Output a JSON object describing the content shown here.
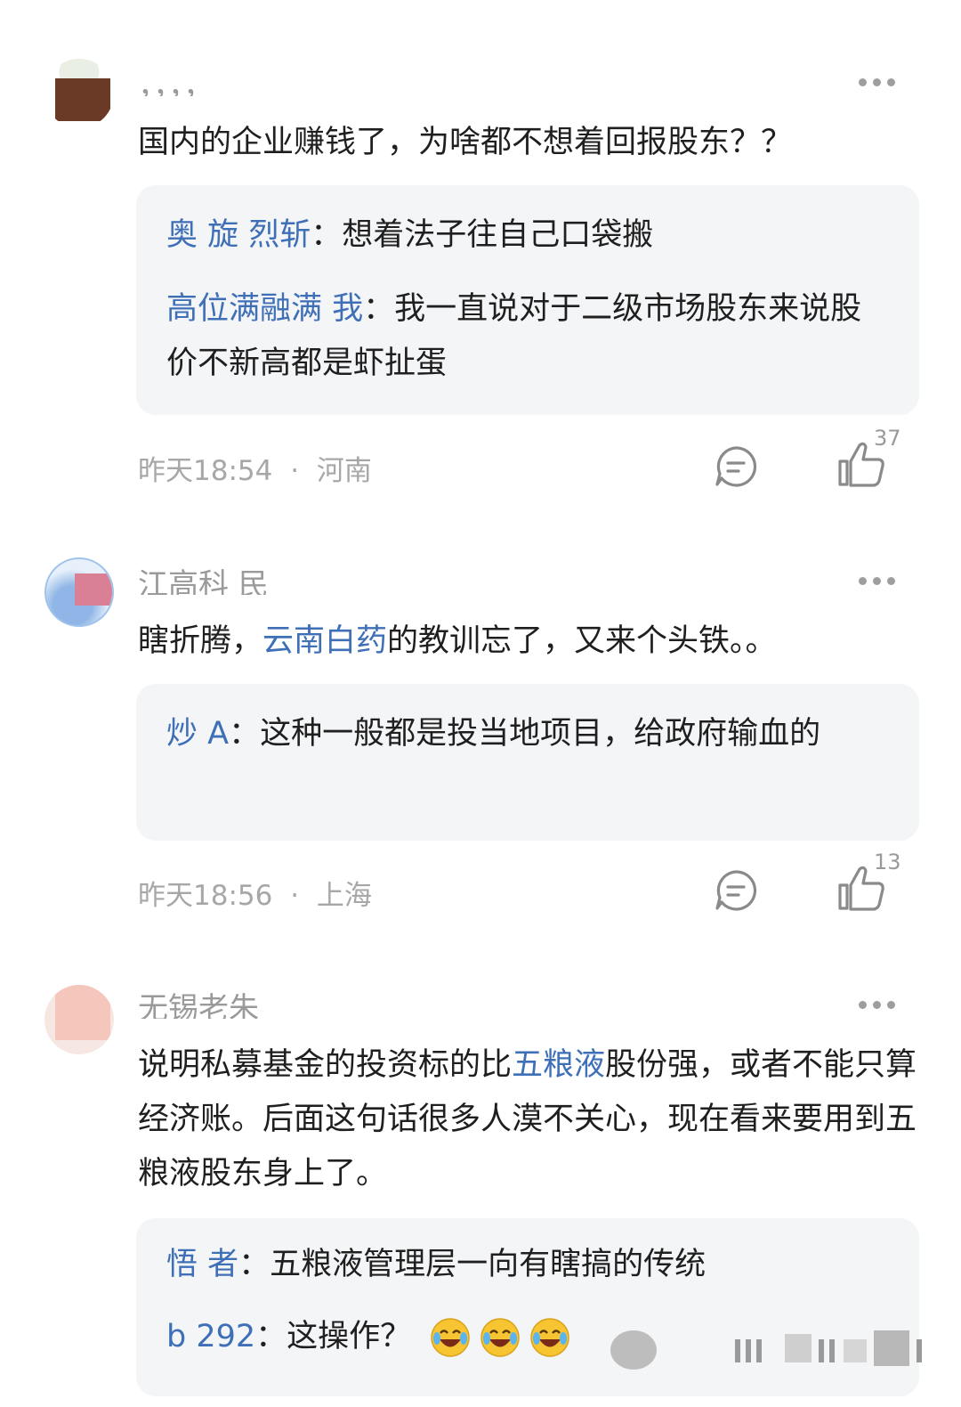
{
  "comments": [
    {
      "username": "，，，，",
      "text": "国内的企业赚钱了，为啥都不想着回报股东？？",
      "replies": [
        {
          "name": "奥 旋 烈斩",
          "sep": "：",
          "text": "想着法子往自己口袋搬"
        },
        {
          "name": "高位满融满 我",
          "sep": "：",
          "text": "我一直说对于二级市场股东来说股价不新高都是虾扯蛋"
        }
      ],
      "time": "昨天18:54",
      "dot": "·",
      "location": "河南",
      "likes": "37"
    },
    {
      "username": "江高科 民",
      "text_before": "瞎折腾，",
      "text_link": "云南白药",
      "text_after": "的教训忘了，又来个头铁。。",
      "replies": [
        {
          "name": "炒 A",
          "sep": "：",
          "text": "这种一般都是投当地项目，给政府输血的"
        }
      ],
      "time": "昨天18:56",
      "dot": "·",
      "location": "上海",
      "likes": "13"
    },
    {
      "username": "无锡老朱",
      "text_before": "说明私募基金的投资标的比",
      "text_link": "五粮液",
      "text_after": "股份强，或者不能只算经济账。后面这句话很多人漠不关心，现在看来要用到五粮液股东身上了。",
      "replies": [
        {
          "name": "悟 者",
          "sep": "：",
          "text": "五粮液管理层一向有瞎搞的传统"
        },
        {
          "name": "b 292",
          "sep": "：",
          "text": "这操作？"
        }
      ]
    }
  ],
  "icons": {
    "more": "more-dots-icon",
    "reply": "reply-bubble-icon",
    "like": "thumbs-up-icon",
    "emoji": "laughing-crying-emoji-icon"
  },
  "colors": {
    "link": "#3e6fb7",
    "meta": "#a7a7a7",
    "reply_bg": "#f4f5f7"
  }
}
